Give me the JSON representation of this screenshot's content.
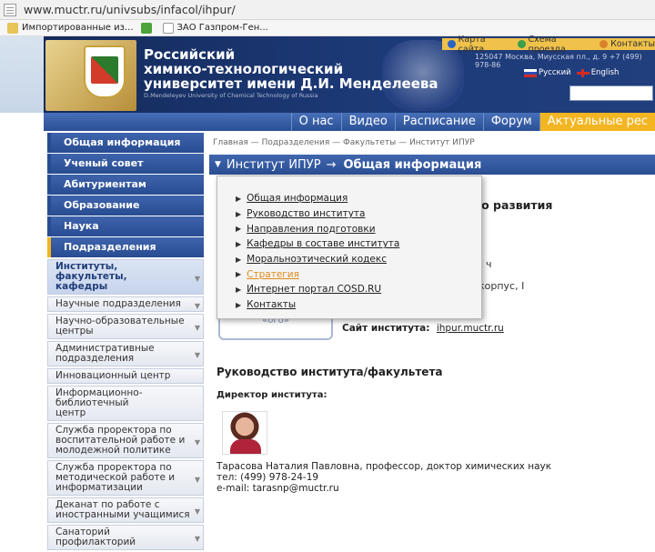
{
  "browser": {
    "url": "www.muctr.ru/univsubs/infacol/ihpur/",
    "bookmarks": [
      "Импортированные из...",
      "",
      "ЗАО Газпром-Ген..."
    ]
  },
  "header": {
    "name_line1": "Российский",
    "name_line2": "химико-технологический",
    "name_line3": "университет имени Д.И. Менделеева",
    "name_en": "D.Mendeleyev University of Chemical Technology of Russia",
    "top_links": [
      "Карта сайта",
      "Схема проезда",
      "Контакты"
    ],
    "address": "125047 Москва, Миусская пл., д. 9    +7 (499) 978-86",
    "lang_ru": "Русский",
    "lang_en": "English"
  },
  "nav": [
    "О нас",
    "Видео",
    "Расписание",
    "Форум",
    "Актуальные рес"
  ],
  "sidebar": {
    "main": [
      "Общая информация",
      "Ученый совет",
      "Абитуриентам",
      "Образование",
      "Наука",
      "Подразделения"
    ],
    "sub": [
      [
        "Институты, факультеты,",
        "кафедры"
      ],
      [
        "Научные подразделения"
      ],
      [
        "Научно-образовательные",
        "центры"
      ],
      [
        "Административные",
        "подразделения"
      ],
      [
        "Инновационный центр"
      ],
      [
        "Информационно-библиотечный",
        "центр"
      ],
      [
        "Служба проректора по",
        "воспитательной работе и",
        "молодежной политике"
      ],
      [
        "Служба проректора по",
        "методической работе и",
        "информатизации"
      ],
      [
        "Деканат по работе с",
        "иностранными учащимися"
      ],
      [
        "Санаторий профилакторий"
      ]
    ]
  },
  "breadcrumb": "Главная — Подразделения — Факультеты — Институт ИПУР",
  "section": {
    "toggle": "▼",
    "institute": "Институт ИПУР",
    "arrow": "→",
    "title": "Общая информация"
  },
  "dropdown": {
    "items": [
      "Общая информация",
      "Руководство института",
      "Направления подготовки",
      "Кафедры в составе института",
      "Моральноэтический кодекс",
      "Стратегия",
      "Интернет портал COSD.RU",
      "Контакты"
    ],
    "hovered_index": 5
  },
  "content": {
    "heading_partial": "ого развития",
    "frag1": "ч",
    "frag2": "корпус, I",
    "logo_partial": "«ого»",
    "site_label": "Сайт института:",
    "site_link": "ihpur.muctr.ru",
    "mgmt_heading": "Руководство института/факультета",
    "director_label": "Директор института:",
    "director_name": "Тарасова Наталия Павловна, профессор, доктор химических наук",
    "director_phone": "тел: (499) 978-24-19",
    "director_email": "e-mail: tarasnp@muctr.ru"
  }
}
